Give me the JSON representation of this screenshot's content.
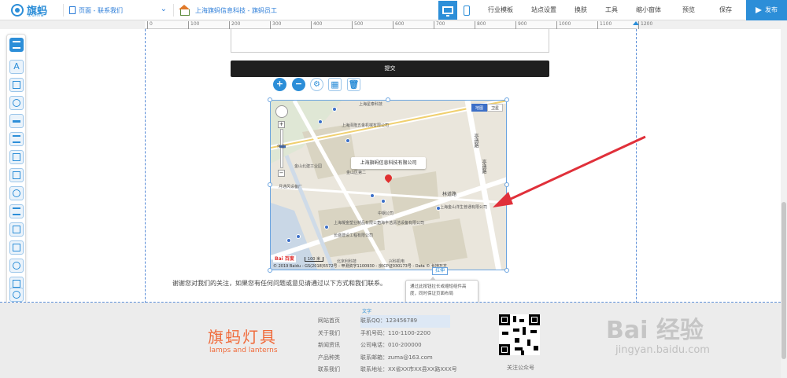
{
  "app": {
    "logo_text": "旗蚂",
    "logo_sub": "zuma"
  },
  "topbar": {
    "page_selector": "页面 - 联系我们",
    "site_name": "上海旗蚂信息科技 - 旗蚂员工",
    "menu": [
      "行业模板",
      "站点设置",
      "换肤",
      "工具",
      "缩小窗体",
      "预览",
      "保存"
    ],
    "publish_label": "发布"
  },
  "ruler": {
    "ticks": [
      "0",
      "100",
      "200",
      "300",
      "400",
      "500",
      "600",
      "700",
      "800",
      "900",
      "1000",
      "1100",
      "1200"
    ]
  },
  "form": {
    "submit_label": "提交"
  },
  "map": {
    "popup_text": "上海旗蚂信息科技有限公司",
    "type_map": "地图",
    "type_satellite": "卫星",
    "scale_label": "100 米",
    "copyright": "© 2019 Baidu - GS(2018)5572号 - 甲测资字1100930 - 京ICP证030173号 - Data © 长地万方",
    "baidu_logo": "Bai 百度",
    "roads": [
      "林道路",
      "亭遗路",
      "亭遗路"
    ],
    "labels": [
      "中国电信",
      "上海泽鑫塑料包装有限公司",
      "上海金山洋生普通有限公司",
      "上海泽隆五金机械有限公司",
      "上海星泰科技",
      "金山区第二",
      "中钢公司",
      "上海凝金塑业制品有限公司",
      "上海丰浩清洁设备有限公司",
      "长盛建设工程有限公司",
      "北京利科技",
      "兴科机电",
      "金山北建工业园",
      "月通风设备厂",
      "伟星厂"
    ]
  },
  "resize_tag": "拉伸",
  "tooltip": "通过此按钮拉长或缩短组件高度，同时保证页面布局",
  "thanks_text": "谢谢您对我们的关注，如果您有任何问题或意见请通过以下方式和我们联系。",
  "footer": {
    "brand_cn": "旗蚂灯具",
    "brand_en": "lamps and lanterns",
    "text_tag": "文字",
    "links": [
      "网站首页",
      "关于我们",
      "新闻资讯",
      "产品种类",
      "联系我们"
    ],
    "info": [
      "联系QQ：123456789",
      "手机号码：110-1100-2200",
      "公司电话：010-200000",
      "联系邮箱：zuma@163.com",
      "联系地址：XX省XX市XX县XX路XXX号"
    ],
    "qr_label": "关注公众号"
  },
  "watermark": {
    "main": "Bai 经验",
    "sub": "jingyan.baidu.com"
  },
  "colors": {
    "accent": "#2c8ed8",
    "brand_orange": "#f06a3a",
    "submit_bg": "#1f1f1f",
    "arrow_red": "#e0303a"
  }
}
